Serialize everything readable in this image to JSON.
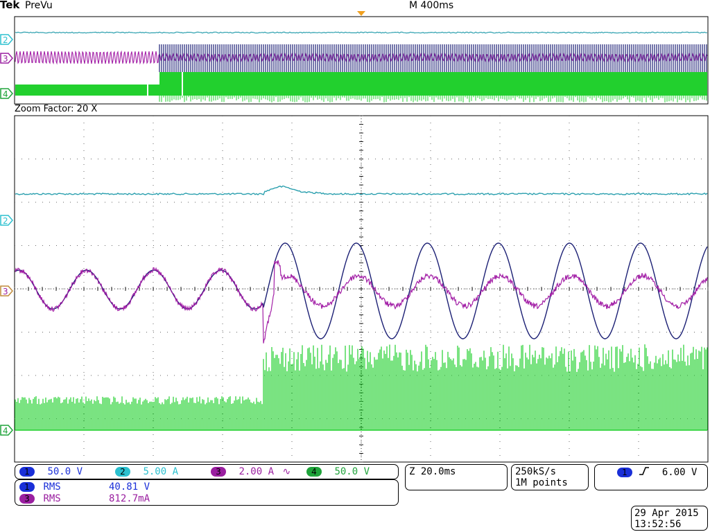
{
  "header": {
    "brand": "Tek",
    "mode": "PreVu",
    "timebase": "M 400ms"
  },
  "zoom": {
    "label": "Zoom Factor: 20 X"
  },
  "channels": [
    {
      "id": "1",
      "scale": "50.0 V",
      "color": "#1a2fd8"
    },
    {
      "id": "2",
      "scale": "5.00 A",
      "color": "#2bc0cf"
    },
    {
      "id": "3",
      "scale": "2.00 A",
      "extra": "∿",
      "color": "#9a1fa0"
    },
    {
      "id": "4",
      "scale": "50.0 V",
      "color": "#1fa33a"
    }
  ],
  "markers": {
    "ch2": "2",
    "ch3": "3",
    "ch4": "4"
  },
  "measurements": [
    {
      "ch": "1",
      "label": "RMS",
      "value": "40.81 V"
    },
    {
      "ch": "3",
      "label": "RMS",
      "value": "812.7mA"
    }
  ],
  "zoom_timebase": "Z 20.0ms",
  "acquisition": {
    "rate": "250kS/s",
    "points": "1M points"
  },
  "trigger": {
    "ch": "1",
    "slope": "rising",
    "level": "6.00 V"
  },
  "datetime": {
    "date": "29 Apr  2015",
    "time": "13:52:56"
  },
  "colors": {
    "trace1": "#1b1f74",
    "trace2": "#2a9fae",
    "trace3": "#a21ea6",
    "trace4": "#22d02e",
    "grid": "#666666"
  }
}
